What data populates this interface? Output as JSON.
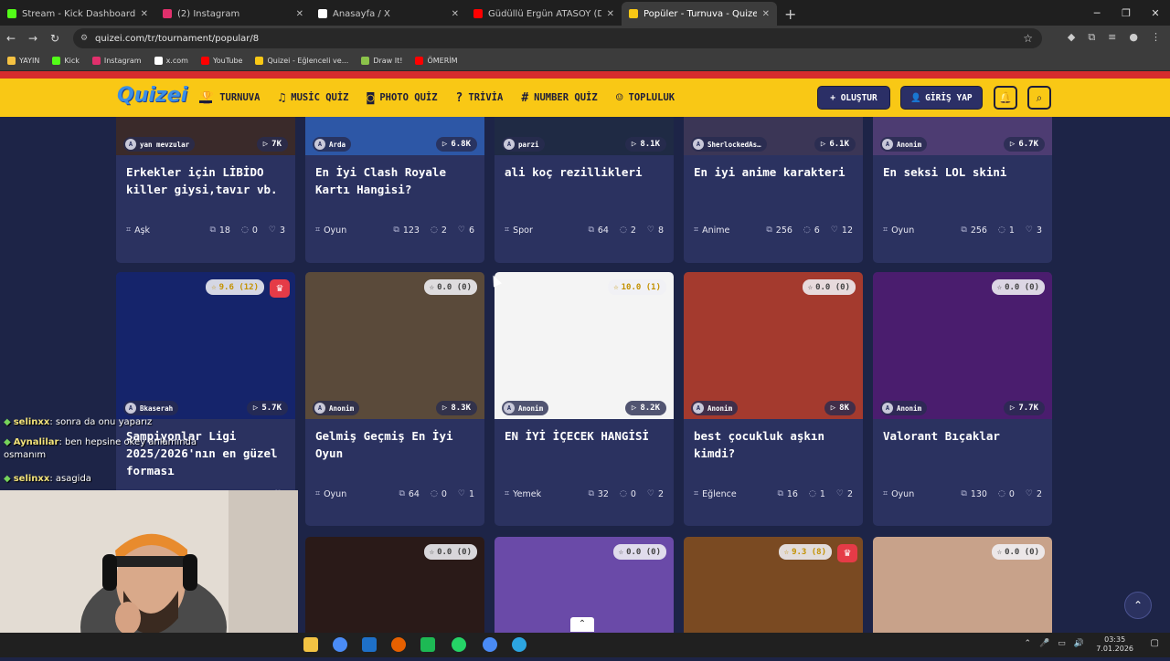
{
  "browser": {
    "tabs": [
      {
        "title": "Stream - Kick Dashboard",
        "color": "#53fc18",
        "active": false
      },
      {
        "title": "(2) Instagram",
        "color": "#e1306c",
        "active": false
      },
      {
        "title": "Anasayfa / X",
        "color": "#ffffff",
        "active": false
      },
      {
        "title": "Güdüllü Ergün ATASOY (Dağlar…",
        "color": "#ff0000",
        "active": false
      },
      {
        "title": "Popüler - Turnuva - Quizei",
        "color": "#f9c815",
        "active": true
      }
    ],
    "url": "quizei.com/tr/tournament/popular/8",
    "bookmarks": [
      {
        "label": "YAYIN",
        "color": "#f5c242"
      },
      {
        "label": "Kick",
        "color": "#53fc18"
      },
      {
        "label": "Instagram",
        "color": "#e1306c"
      },
      {
        "label": "x.com",
        "color": "#ffffff"
      },
      {
        "label": "YouTube",
        "color": "#ff0000"
      },
      {
        "label": "Quizei - Eğlenceli ve...",
        "color": "#f9c815"
      },
      {
        "label": "Draw It!",
        "color": "#8bc34a"
      },
      {
        "label": "ÖMERİM",
        "color": "#ff0000"
      }
    ]
  },
  "site": {
    "logo": "Quizei",
    "nav": [
      {
        "label": "TURNUVA",
        "icon": "trophy-icon",
        "glyph": "🏆"
      },
      {
        "label": "MUSİC QUİZ",
        "icon": "music-icon",
        "glyph": "♫"
      },
      {
        "label": "PHOTO QUİZ",
        "icon": "camera-icon",
        "glyph": "◙"
      },
      {
        "label": "TRİVİA",
        "icon": "chat-icon",
        "glyph": "?"
      },
      {
        "label": "NUMBER QUİZ",
        "icon": "hash-icon",
        "glyph": "#"
      },
      {
        "label": "TOPLULUK",
        "icon": "users-icon",
        "glyph": "☺"
      }
    ],
    "create_label": "+ OLUŞTUR",
    "login_label": "GİRİŞ YAP"
  },
  "cards_row1": [
    {
      "author": "yan mevzular",
      "views": "7K",
      "title": "Erkekler için LİBİDO killer giysi,tavır vb.",
      "category": "Aşk",
      "items": "18",
      "comments": "0",
      "likes": "3"
    },
    {
      "author": "Arda",
      "views": "6.8K",
      "title": "En İyi Clash Royale Kartı Hangisi?",
      "category": "Oyun",
      "items": "123",
      "comments": "2",
      "likes": "6"
    },
    {
      "author": "parzi",
      "views": "8.1K",
      "title": "ali koç rezillikleri",
      "category": "Spor",
      "items": "64",
      "comments": "2",
      "likes": "8"
    },
    {
      "author": "SherlockedAs…",
      "views": "6.1K",
      "title": "En iyi anime karakteri",
      "category": "Anime",
      "items": "256",
      "comments": "6",
      "likes": "12"
    },
    {
      "author": "Anonim",
      "views": "6.7K",
      "title": "En seksi LOL skini",
      "category": "Oyun",
      "items": "256",
      "comments": "1",
      "likes": "3"
    }
  ],
  "cards_row2": [
    {
      "author": "Bkaserah",
      "views": "5.7K",
      "rating": "9.6 (12)",
      "title": "Şampiyonlar Ligi 2025/2026'nın en güzel forması",
      "category": "",
      "items": "",
      "comments": "",
      "likes": "",
      "crown": true
    },
    {
      "author": "Anonim",
      "views": "8.3K",
      "rating": "0.0 (0)",
      "title": "Gelmiş Geçmiş En İyi Oyun",
      "category": "Oyun",
      "items": "64",
      "comments": "0",
      "likes": "1"
    },
    {
      "author": "Anonim",
      "views": "8.2K",
      "rating": "10.0 (1)",
      "title": "EN İYİ İÇECEK HANGİSİ",
      "category": "Yemek",
      "items": "32",
      "comments": "0",
      "likes": "2"
    },
    {
      "author": "Anonim",
      "views": "8K",
      "rating": "0.0 (0)",
      "title": "best çocukluk aşkın kimdi?",
      "category": "Eğlence",
      "items": "16",
      "comments": "1",
      "likes": "2"
    },
    {
      "author": "Anonim",
      "views": "7.7K",
      "rating": "0.0 (0)",
      "title": "Valorant Bıçaklar",
      "category": "Oyun",
      "items": "130",
      "comments": "0",
      "likes": "2"
    }
  ],
  "cards_row3": [
    {
      "rating": "0.0 (0)"
    },
    {
      "rating": "0.0 (0)"
    },
    {
      "rating": "9.3 (8)",
      "crown": true
    },
    {
      "rating": "0.0 (0)"
    }
  ],
  "chat": [
    {
      "user": "selinxx",
      "message": ": sonra da onu yaparız"
    },
    {
      "user": "Aynalilar",
      "message": ": ben hepsine okey anlamında osmanım"
    },
    {
      "user": "selinxx",
      "message": ":  asagida"
    }
  ],
  "taskbar": {
    "time": "03:35",
    "date": "7.01.2026"
  }
}
